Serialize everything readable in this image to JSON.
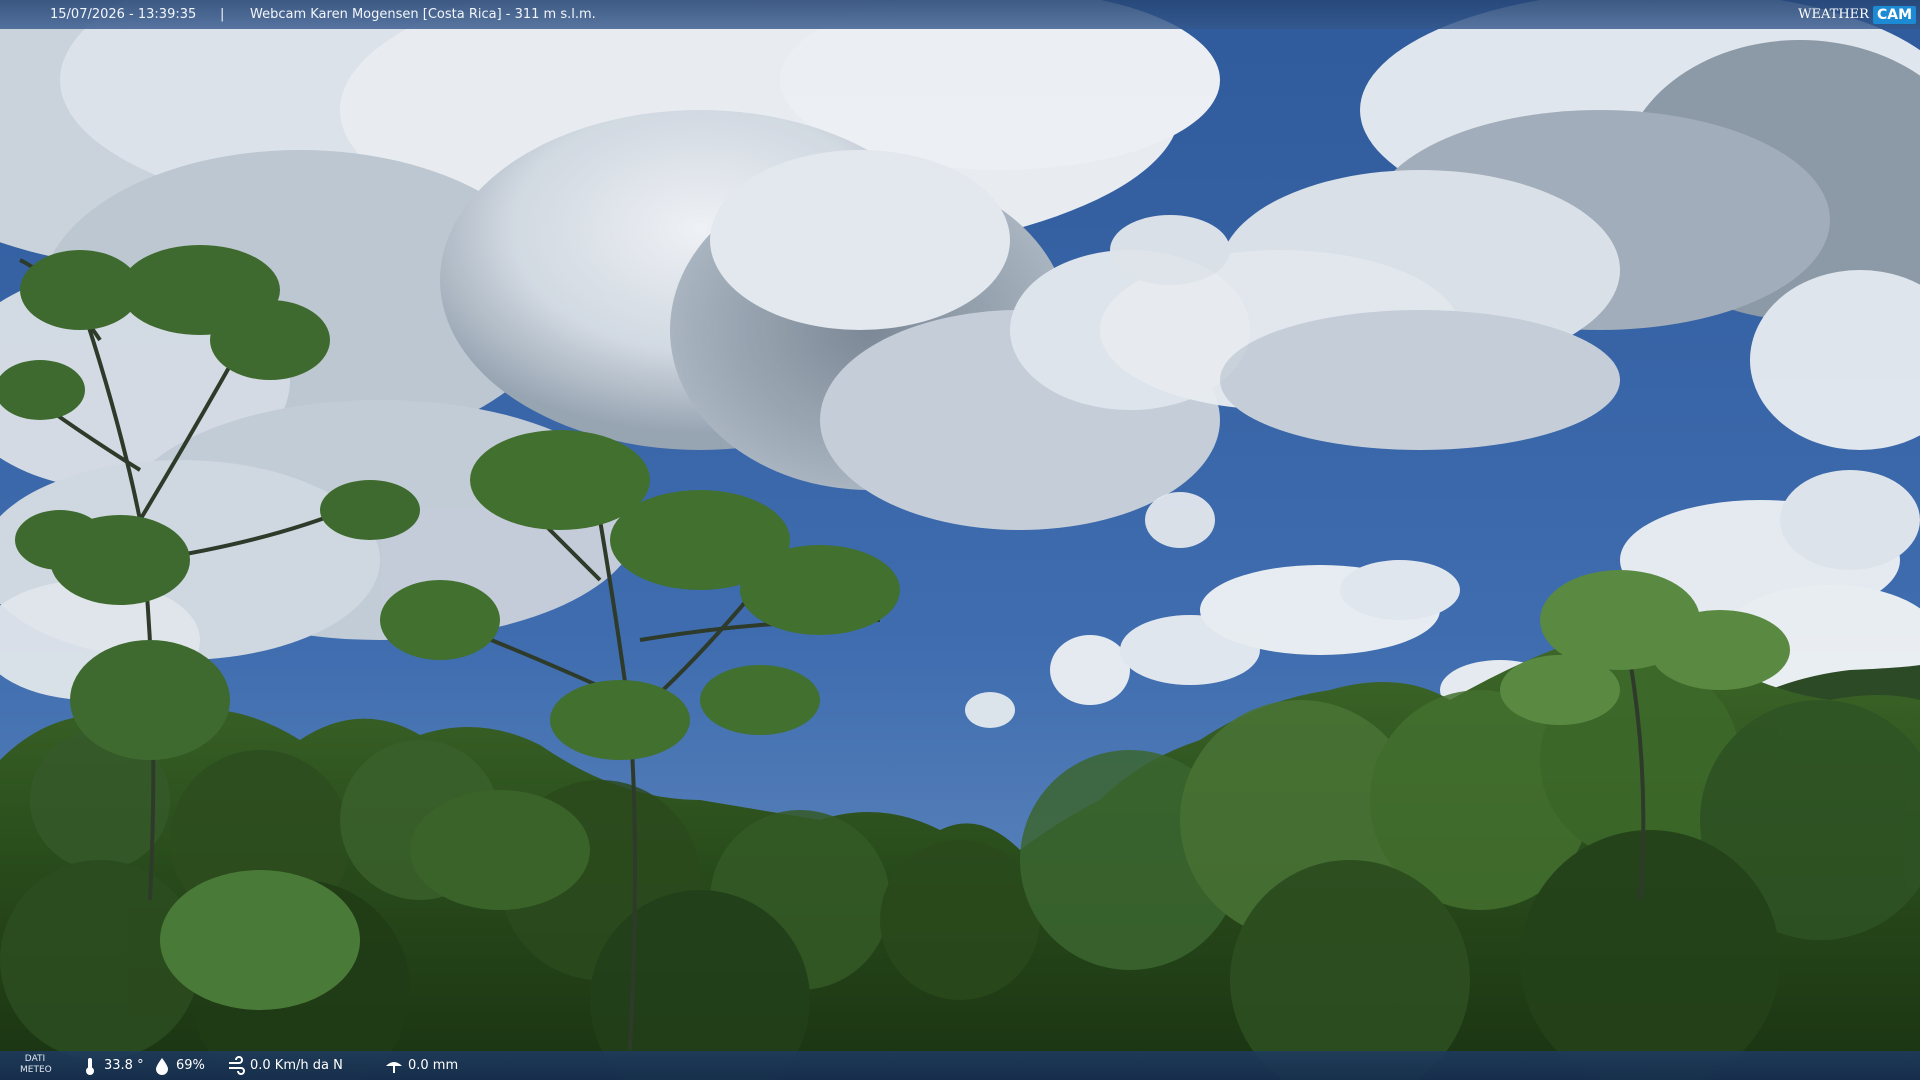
{
  "header": {
    "timestamp": "15/07/2026 - 13:39:35",
    "separator": "|",
    "camera_title": "Webcam Karen Mogensen [Costa Rica] - 311 m s.l.m."
  },
  "logo": {
    "word": "WEATHER",
    "mark": "CAM",
    "colors": {
      "mark_bg": "#1d8ad4"
    }
  },
  "weather": {
    "label_line1": "DATI",
    "label_line2": "METEO",
    "temperature": "33.8 °",
    "humidity": "69%",
    "wind": "0.0 Km/h da N",
    "rain": "0.0 mm",
    "icons": [
      "thermometer-icon",
      "humidity-drop-icon",
      "wind-icon",
      "rain-icon"
    ]
  },
  "scene": {
    "description_colors": {
      "sky": "#3d6aac",
      "cloud": "#e8edf2",
      "cloud_shadow": "#8e9aa6",
      "foliage_dark": "#1f3a15",
      "foliage_mid": "#3c6428",
      "foliage_light": "#6f9a4a"
    }
  }
}
